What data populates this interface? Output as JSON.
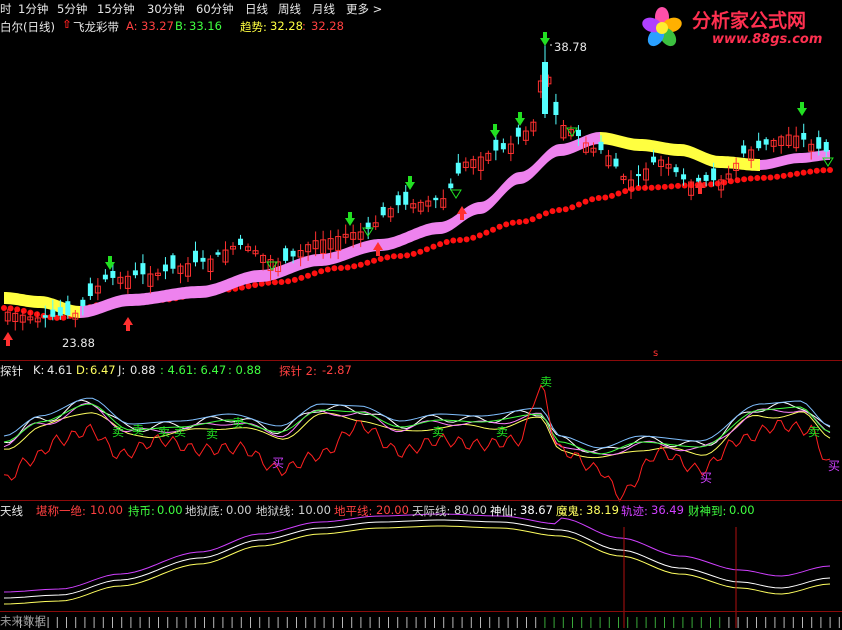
{
  "toolbar": {
    "items": [
      "时",
      "1分钟",
      "5分钟",
      "15分钟",
      "30分钟",
      "60分钟",
      "日线",
      "周线",
      "月线",
      "更多 >"
    ]
  },
  "logo": {
    "title": "分析家公式网",
    "url": "www.88gs.com"
  },
  "main_panel": {
    "indicator_name": "白尔(日线)",
    "band_name": "飞龙彩带",
    "a_label": "A:",
    "a_value": "33.27",
    "b_label": "B:",
    "b_value": "33.16",
    "trend_label": "趋势:",
    "trend_value1": "32.28",
    "trend_value2": "32.28",
    "high_marker": "38.78",
    "low_marker": "23.88",
    "s_marker": "s"
  },
  "probe_panel": {
    "name": "探针",
    "k_label": "K:",
    "k_value": "4.61",
    "d_label": "D:",
    "d_value": "6.47",
    "j_label": "J:",
    "j_value": "0.88",
    "v1": "4.61",
    "v2": "6.47",
    "v3": "0.88",
    "probe2_label": "探针 2:",
    "probe2_value": "-2.87",
    "sell": "卖",
    "buy": "买"
  },
  "sky_panel": {
    "name": "天线",
    "f1_label": "堪称一绝:",
    "f1_value": "10.00",
    "f2_label": "持币:",
    "f2_value": "0.00",
    "f3_label": "地狱底:",
    "f3_value": "0.00",
    "f4_label": "地狱线:",
    "f4_value": "10.00",
    "f5_label": "地平线:",
    "f5_value": "20.00",
    "f6_label": "天际线:",
    "f6_value": "80.00",
    "f7_label": "神仙:",
    "f7_value": "38.67",
    "f8_label": "魔鬼:",
    "f8_value": "38.19",
    "f9_label": "轨迹:",
    "f9_value": "36.49",
    "f10_label": "财神到:",
    "f10_value": "0.00"
  },
  "bottom_panel": {
    "label": "未来数据"
  },
  "colors": {
    "up": "#ff3030",
    "down": "#54ffff",
    "ribbon_pink": "#ee82ee",
    "ribbon_yellow": "#ffff40",
    "dot_red": "#ff1010",
    "green": "#22e022",
    "purple": "#d040ff",
    "white": "#ffffff",
    "yellow": "#ffff60"
  }
}
